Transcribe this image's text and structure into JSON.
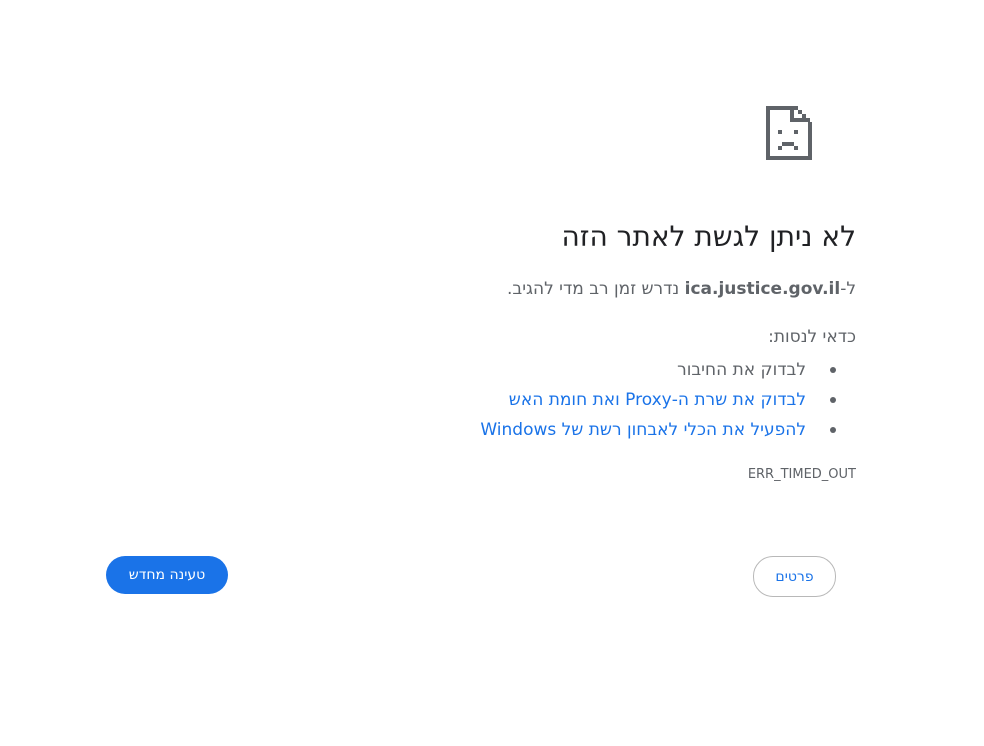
{
  "error": {
    "title": "לא ניתן לגשת לאתר הזה",
    "message_prefix": "ל-",
    "host": "ica.justice.gov.il",
    "message_suffix": " נדרש זמן רב מדי להגיב.",
    "try_label": "כדאי לנסות:",
    "suggestions": [
      {
        "label": "לבדוק את החיבור",
        "is_link": false
      },
      {
        "label": "לבדוק את שרת ה-Proxy ואת חומת האש",
        "is_link": true
      },
      {
        "label": "להפעיל את הכלי לאבחון רשת של Windows",
        "is_link": true
      }
    ],
    "code": "ERR_TIMED_OUT",
    "icon": "sad-document-icon"
  },
  "buttons": {
    "reload_label": "טעינה מחדש",
    "details_label": "פרטים"
  },
  "colors": {
    "accent": "#1a73e8",
    "text": "#202124",
    "secondary_text": "#5f6368"
  }
}
